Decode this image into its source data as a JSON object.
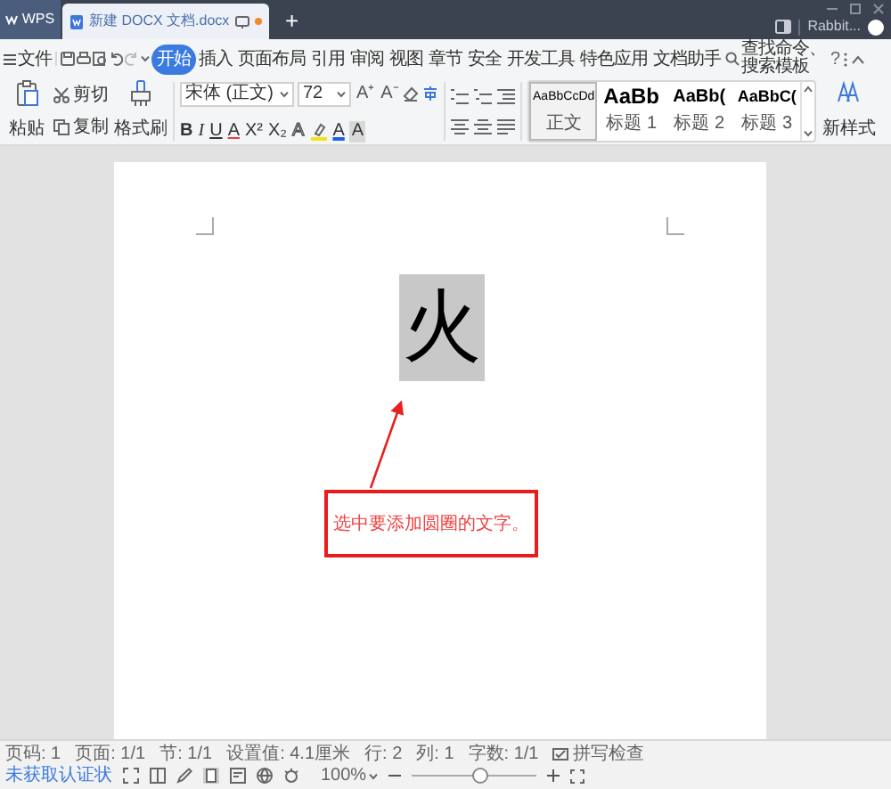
{
  "title_bar": {
    "app_tab": "WPS",
    "doc_tab": {
      "title": "新建 DOCX 文档.docx",
      "modified": true
    },
    "new_tab": "+",
    "user": "Rabbit..."
  },
  "menu": {
    "file": "文件",
    "tabs": [
      {
        "label": "开始",
        "selected": true
      },
      {
        "label": "插入",
        "selected": false
      },
      {
        "label": "页面布局",
        "selected": false
      },
      {
        "label": "引用",
        "selected": false
      },
      {
        "label": "审阅",
        "selected": false
      },
      {
        "label": "视图",
        "selected": false
      },
      {
        "label": "章节",
        "selected": false
      },
      {
        "label": "安全",
        "selected": false
      },
      {
        "label": "开发工具",
        "selected": false
      },
      {
        "label": "特色应用",
        "selected": false
      },
      {
        "label": "文档助手",
        "selected": false
      }
    ],
    "search": "查找命令、搜索模板",
    "help": "?"
  },
  "toolbar": {
    "paste": "粘贴",
    "cut": "剪切",
    "copy": "复制",
    "format_painter": "格式刷",
    "font": "宋体 (正文)",
    "size": "72",
    "size_buttons": [
      "A⁺",
      "A⁻"
    ],
    "format_buttons": [
      {
        "text": "B",
        "kind": "bold"
      },
      {
        "text": "I",
        "kind": "italic"
      },
      {
        "text": "U",
        "kind": "underline"
      },
      {
        "text": "A",
        "kind": "red"
      },
      {
        "text": "X²",
        "kind": "plain"
      },
      {
        "text": "X₂",
        "kind": "plain"
      },
      {
        "text": "A",
        "kind": "outline"
      },
      {
        "text": "A",
        "kind": "color"
      },
      {
        "text": "A",
        "kind": "shade"
      }
    ],
    "styles": [
      {
        "preview": "AaBbCcDd",
        "label": "正文",
        "kind": "body",
        "selected": true
      },
      {
        "preview": "AaBb",
        "label": "标题 1",
        "kind": "h1",
        "selected": false
      },
      {
        "preview": "AaBb(",
        "label": "标题 2",
        "kind": "h2",
        "selected": false
      },
      {
        "preview": "AaBbC(",
        "label": "标题 3",
        "kind": "h3",
        "selected": false
      }
    ],
    "new_style": "新样式"
  },
  "document": {
    "selected_text": "火",
    "note": "选中要添加圆圈的文字。"
  },
  "status_bar": {
    "items": [
      "页码: 1",
      "页面: 1/1",
      "节: 1/1",
      "设置值: 4.1厘米",
      "行: 2",
      "列: 1",
      "字数: 1/1"
    ],
    "spell_check": "拼写检查",
    "auth": "未获取认证状",
    "zoom": "100%",
    "zoom_slider": {
      "level": 0.55
    }
  }
}
